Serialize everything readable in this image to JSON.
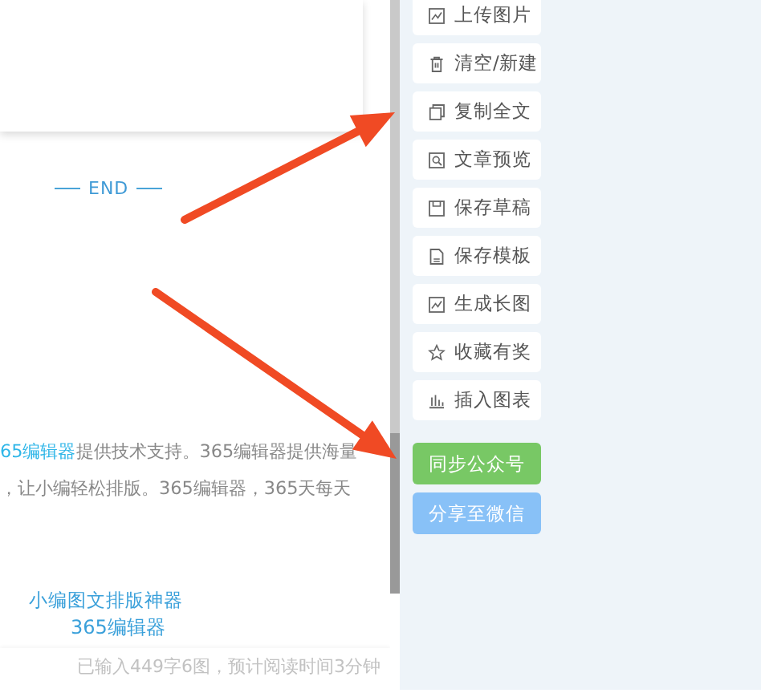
{
  "editor": {
    "end_mark": "END",
    "paragraph_lines": [
      [
        {
          "text": "65编辑器",
          "highlight": true
        },
        {
          "text": "提供技术支持。365编辑器提供海量",
          "highlight": false
        }
      ],
      [
        {
          "text": "，让小编轻松排版。365编辑器，365天每天",
          "highlight": false
        }
      ]
    ],
    "logo_lines": [
      "小编图文排版神器",
      "365编辑器"
    ],
    "status": "已输入449字6图，预计阅读时间3分钟"
  },
  "toolbar": {
    "items": [
      {
        "label": "上传图片"
      },
      {
        "label": "清空/新建"
      },
      {
        "label": "复制全文"
      },
      {
        "label": "文章预览"
      },
      {
        "label": "保存草稿"
      },
      {
        "label": "保存模板"
      },
      {
        "label": "生成长图"
      },
      {
        "label": "收藏有奖"
      },
      {
        "label": "插入图表"
      }
    ]
  },
  "actions": [
    {
      "label": "同步公众号",
      "kind": "sync"
    },
    {
      "label": "分享至微信",
      "kind": "share"
    }
  ]
}
